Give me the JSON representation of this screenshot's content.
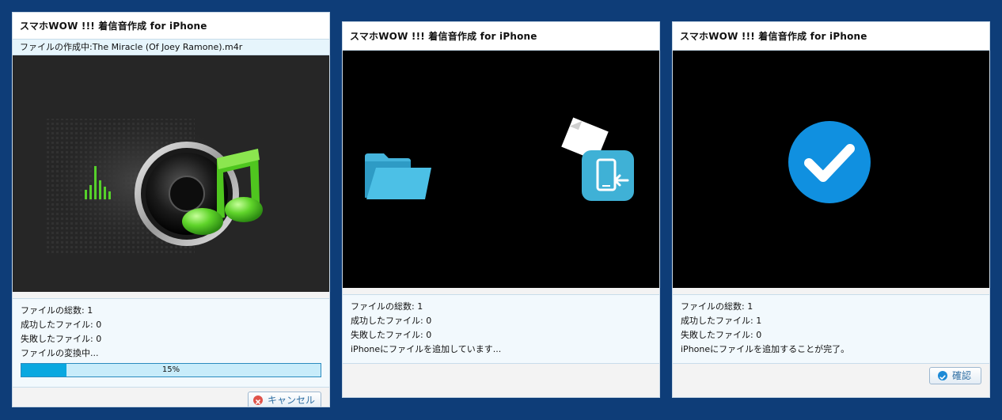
{
  "panels": [
    {
      "title": "スマホWOW !!! 着信音作成 for iPhone",
      "subtitle": "ファイルの作成中:The Miracle (Of Joey Ramone).m4r",
      "info": [
        "ファイルの総数: 1",
        "成功したファイル: 0",
        "失敗したファイル: 0",
        "ファイルの変換中..."
      ],
      "progress": {
        "value": 0.15,
        "label": "15%"
      },
      "button": {
        "label": "キャンセル",
        "icon": "cancel-icon"
      },
      "graphic": "speaker-music-note"
    },
    {
      "title": "スマホWOW !!! 着信音作成 for iPhone",
      "info": [
        "ファイルの総数: 1",
        "成功したファイル: 0",
        "失敗したファイル: 0",
        "iPhoneにファイルを追加しています..."
      ],
      "graphic": "folder-to-phone-transfer"
    },
    {
      "title": "スマホWOW !!! 着信音作成 for iPhone",
      "info": [
        "ファイルの総数: 1",
        "成功したファイル: 1",
        "失敗したファイル: 0",
        "iPhoneにファイルを追加することが完了。"
      ],
      "button": {
        "label": "確認",
        "icon": "check-circle-icon"
      },
      "graphic": "check-circle"
    }
  ],
  "colors": {
    "background": "#0e3d78",
    "accent": "#0aa8e0",
    "check": "#1090e0",
    "folder": "#45b4dc"
  }
}
